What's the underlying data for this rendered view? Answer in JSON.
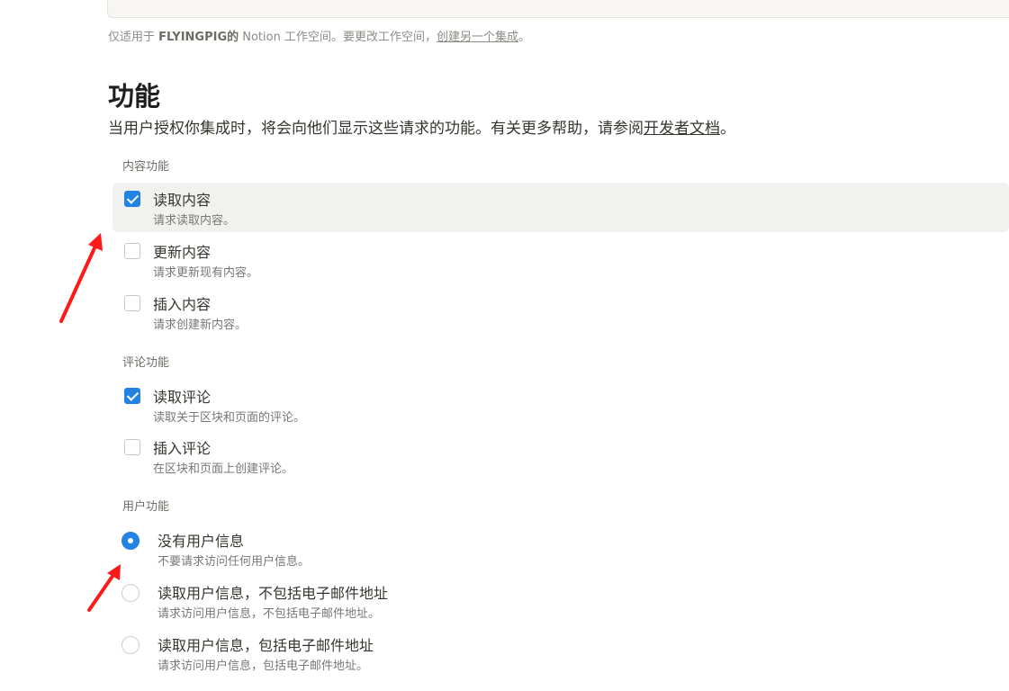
{
  "token": {
    "masked_value": "••••••••••••••••••••••••••••••••••••"
  },
  "workspace_note": {
    "prefix": "仅适用于 ",
    "workspace": "FLYINGPIG的",
    "middle": " Notion 工作空间。要更改工作空间，",
    "link": "创建另一个集成",
    "suffix": "。"
  },
  "capabilities": {
    "title": "功能",
    "description_prefix": "当用户授权你集成时，将会向他们显示这些请求的功能。有关更多帮助，请参阅",
    "description_link": "开发者文档",
    "description_suffix": "。"
  },
  "content_group": {
    "label": "内容功能",
    "options": [
      {
        "title": "读取内容",
        "subtitle": "请求读取内容。",
        "checked": true
      },
      {
        "title": "更新内容",
        "subtitle": "请求更新现有内容。",
        "checked": false
      },
      {
        "title": "插入内容",
        "subtitle": "请求创建新内容。",
        "checked": false
      }
    ]
  },
  "comment_group": {
    "label": "评论功能",
    "options": [
      {
        "title": "读取评论",
        "subtitle": "读取关于区块和页面的评论。",
        "checked": true
      },
      {
        "title": "插入评论",
        "subtitle": "在区块和页面上创建评论。",
        "checked": false
      }
    ]
  },
  "user_group": {
    "label": "用户功能",
    "options": [
      {
        "title": "没有用户信息",
        "subtitle": "不要请求访问任何用户信息。",
        "selected": true
      },
      {
        "title": "读取用户信息，不包括电子邮件地址",
        "subtitle": "请求访问用户信息，不包括电子邮件地址。",
        "selected": false
      },
      {
        "title": "读取用户信息，包括电子邮件地址",
        "subtitle": "请求访问用户信息，包括电子邮件地址。",
        "selected": false
      }
    ]
  },
  "colors": {
    "accent": "#2383e2",
    "annotation_arrow": "#ff1a1a",
    "hover_row": "#f1f1ef"
  }
}
